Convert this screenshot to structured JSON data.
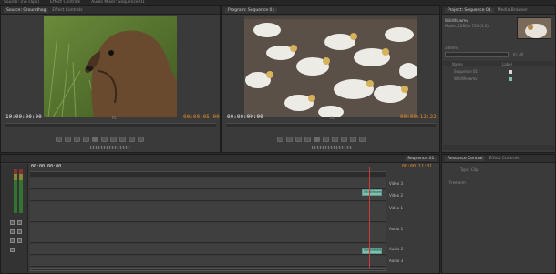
{
  "menubar": {
    "items": [
      "Source: (no clips)",
      "Effect Controls",
      "Audio Mixer: Sequence 01",
      "Metadata"
    ]
  },
  "source_monitor": {
    "tab_label": "Source: Groundhog",
    "timecode_in": "00:00:00:00",
    "timecode_duration": "00:00:05:00",
    "timecode_in_label": "10:00:00:00",
    "zoom": "Fit"
  },
  "program_monitor": {
    "tab_label": "Program: Sequence 01",
    "timecode_in": "00:00:00:00",
    "timecode_duration": "00:00:12:22",
    "zoom": "Fit"
  },
  "project_panel": {
    "tabs": [
      "Project: Sequence 01",
      "Media Browser",
      "Info",
      "Effects"
    ],
    "clip_name": "Wildlife.wmv",
    "clip_info": "Movie, 1280 x 720 (1.0)",
    "item_count": "3 Items",
    "search_placeholder": "In: All",
    "column_name": "Name",
    "column_label": "Label",
    "items": [
      "Sequence 01",
      "Wildlife.wmv"
    ]
  },
  "timeline": {
    "tab_label": "Sequence 01",
    "timecode": "00:00:00:00",
    "end_timecode": "00:00:11:01",
    "tracks": [
      "Video 3",
      "Video 2",
      "Video 1",
      "Audio 1",
      "Audio 2",
      "Audio 3"
    ],
    "clip_label": "Wildlife.wmv"
  },
  "right_bottom_panel": {
    "tabs": [
      "Resource Central",
      "Effect Controls"
    ],
    "label": "Type: Clip",
    "section": "Freeform"
  },
  "colors": {
    "clip": "#7fbfb0",
    "timecode_orange": "#e08a2a",
    "playhead": "#d23a3a"
  }
}
